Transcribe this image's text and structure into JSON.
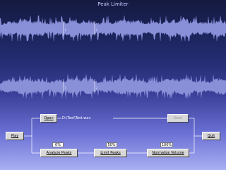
{
  "window": {
    "title": "Peak Limiter"
  },
  "buttons": {
    "play": "Play",
    "open": "Open",
    "save": "Save",
    "quit": "Quit",
    "analyze": "Analyze Peaks",
    "limit": "Limit Peaks",
    "normalize": "Normalize Volume"
  },
  "file_path": "D:\\Test\\Test.wav",
  "values": {
    "analyze_pct": "0%",
    "limit_pct": "50%",
    "normalize_pct": "100%"
  },
  "markers": {
    "start": "1",
    "end": "2"
  },
  "colors": {
    "waveform": "#8a90d8",
    "flow_line": "#ffffff",
    "button_face": "#d8d8d8"
  }
}
